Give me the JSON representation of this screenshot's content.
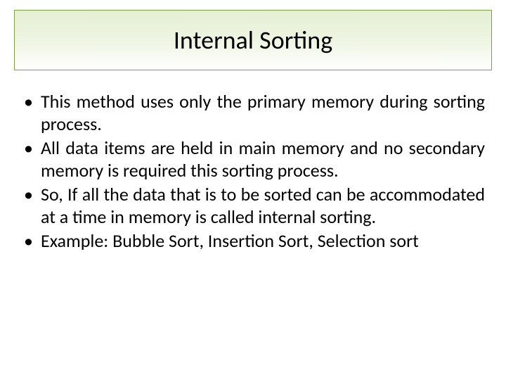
{
  "title": "Internal Sorting",
  "bullets": {
    "b0": "This method uses only the primary memory during sorting process.",
    "b1": "All data items are held in main memory and no secondary memory is required this sorting process.",
    "b2": "So, If all the data that is to be sorted can be accommodated at a time in memory is called internal sorting.",
    "b3": "Example: Bubble Sort, Insertion Sort, Selection sort"
  },
  "marker": "•"
}
